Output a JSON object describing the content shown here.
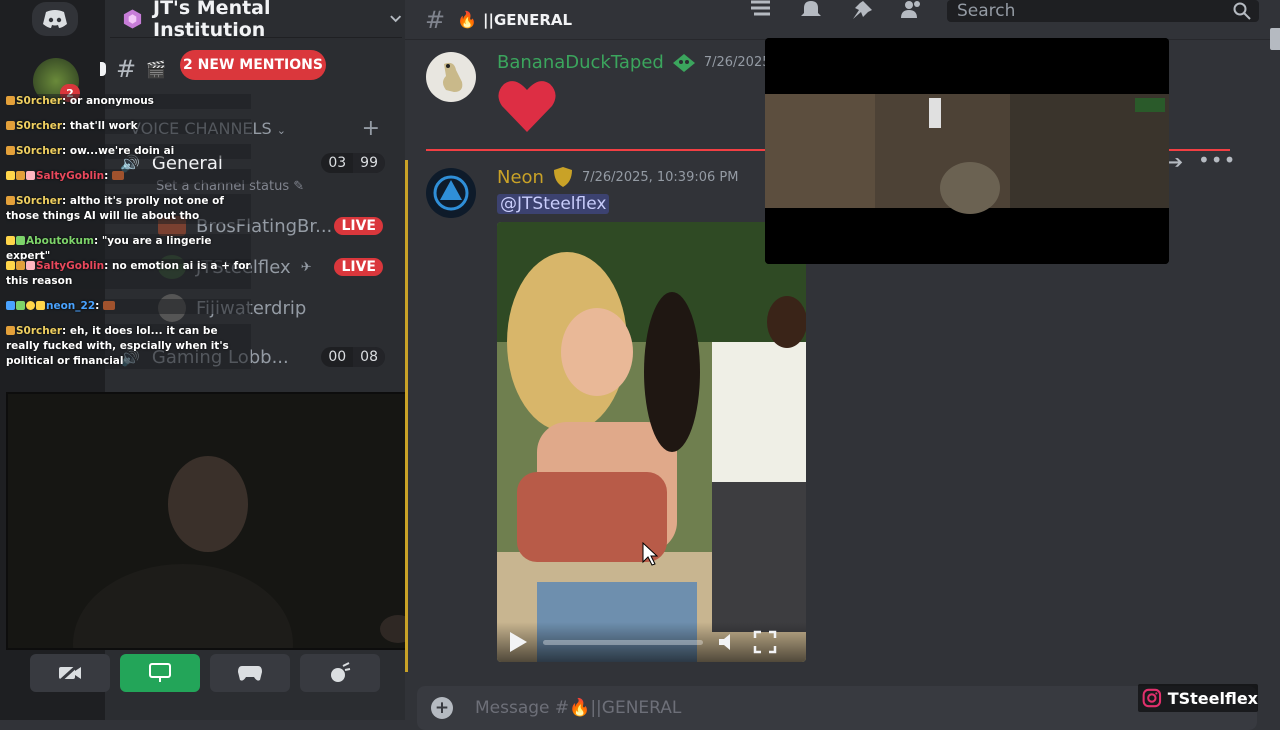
{
  "server": {
    "name": "JT's Mental Institution",
    "mention_count": "2"
  },
  "channel": {
    "name": "||GENERAL",
    "emoji": "🔥",
    "placeholder": "Message #🔥||GENERAL"
  },
  "search": {
    "placeholder": "Search"
  },
  "sidebar": {
    "new_mentions": "2 NEW MENTIONS",
    "voice_header": "VOICE CHANNELS",
    "voice_channels": [
      {
        "name": "General",
        "count_a": "03",
        "count_b": "99",
        "status": "Set a channel status"
      },
      {
        "name": "BrosFlatingBr...",
        "live": "LIVE"
      },
      {
        "name": "JTSteelflex",
        "live": "LIVE"
      },
      {
        "name": "Fijiwaterdrip"
      },
      {
        "name": "Gaming Lobb...",
        "count_a": "00",
        "count_b": "08"
      }
    ]
  },
  "stream_chat": [
    {
      "user": "S0rcher",
      "user_color": "#f0d060",
      "text": "or anonymous"
    },
    {
      "user": "S0rcher",
      "user_color": "#f0d060",
      "text": "that'll work"
    },
    {
      "user": "S0rcher",
      "user_color": "#f0d060",
      "text": "ow...we're doin ai"
    },
    {
      "user": "SaltyGoblin",
      "user_color": "#e8485c",
      "text": ""
    },
    {
      "user": "S0rcher",
      "user_color": "#f0d060",
      "text": "altho it's prolly not one of those things AI will lie about tho"
    },
    {
      "user": "Aboutokum",
      "user_color": "#7dd36a",
      "text": "\"you are a lingerie expert\""
    },
    {
      "user": "SaltyGoblin",
      "user_color": "#e8485c",
      "text": "no emotion ai is a + for this reason"
    },
    {
      "user": "neon_22",
      "user_color": "#4aa3ff",
      "text": ""
    },
    {
      "user": "S0rcher",
      "user_color": "#f0d060",
      "text": "eh, it does lol... it can be really fucked with, espcially when it's political or financial"
    }
  ],
  "messages": [
    {
      "author": "BananaDuckTaped",
      "author_color": "#3ba55d",
      "timestamp": "7/26/2025",
      "content": "❤"
    },
    {
      "author": "Neon",
      "author_color": "#c9a227",
      "timestamp": "7/26/2025, 10:39:06 PM",
      "mention": "@JTSteelflex"
    }
  ],
  "overlay": {
    "instagram_handle": "TSteelflex"
  },
  "colors": {
    "live": "#da373c",
    "mention_bg": "#3c4270",
    "accent_green": "#23a559"
  }
}
